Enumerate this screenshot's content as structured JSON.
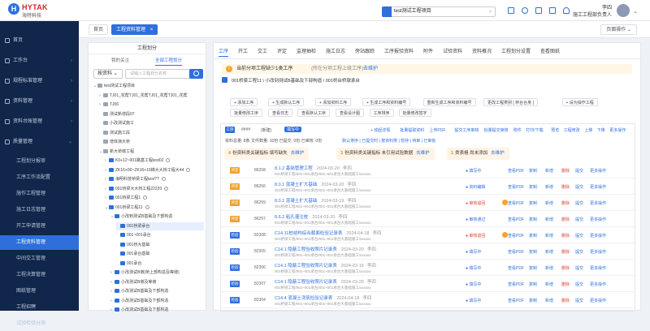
{
  "brand": {
    "logo_en": "HYTAK",
    "logo_cn": "海特科技"
  },
  "header": {
    "project": "test测试工程项目",
    "user_name": "李四",
    "user_role": "施工工程部负责人"
  },
  "sidebar": {
    "items": [
      {
        "label": "首页",
        "sub": false,
        "arrow": ""
      },
      {
        "label": "工作台",
        "sub": false,
        "arrow": "›"
      },
      {
        "label": "规程标准管理",
        "sub": false,
        "arrow": "›"
      },
      {
        "label": "资料管理",
        "sub": false,
        "arrow": "›"
      },
      {
        "label": "资料台账管理",
        "sub": false,
        "arrow": "›"
      },
      {
        "label": "质量管理",
        "sub": false,
        "arrow": "⌄"
      },
      {
        "label": "工程划分报审",
        "sub": true
      },
      {
        "label": "工序工作流配置",
        "sub": true
      },
      {
        "label": "施作工程管理",
        "sub": true
      },
      {
        "label": "施工日志管理",
        "sub": true
      },
      {
        "label": "开工申请管理",
        "sub": true
      },
      {
        "label": "工程资料管理",
        "sub": true,
        "active": true
      },
      {
        "label": "中间交工管理",
        "sub": true
      },
      {
        "label": "工程决算管理",
        "sub": true
      },
      {
        "label": "图纸管理",
        "sub": true
      },
      {
        "label": "工程招聘",
        "sub": true
      },
      {
        "label": "试验检验分项",
        "sub": true
      }
    ]
  },
  "tabs": {
    "home": "首页",
    "current": "工程资料管理",
    "close": "×",
    "page_ops": "页面操作 ⌄"
  },
  "tree": {
    "title": "工程划分",
    "subtabs": [
      "我的关注",
      "全部工程划分"
    ],
    "select": "按资料",
    "search_placeholder": "请输入工程划分名称",
    "nodes": [
      {
        "label": "test测试工程项目",
        "indent": 0,
        "caret": "⌄",
        "icon": "fo"
      },
      {
        "label": "TJ01_花帮TJ01_花帮TJ01_花帮TJ01_花帮",
        "indent": 1,
        "caret": "›",
        "icon": "fo"
      },
      {
        "label": "TJ06",
        "indent": 1,
        "caret": "›",
        "icon": "fo"
      },
      {
        "label": "测试新增段07",
        "indent": 1,
        "caret": "",
        "icon": "fo"
      },
      {
        "label": "小改测试施工",
        "indent": 1,
        "caret": "",
        "icon": "fo"
      },
      {
        "label": "测试施工段",
        "indent": 1,
        "caret": "",
        "icon": "fo"
      },
      {
        "label": "增体演大桥",
        "indent": 1,
        "caret": "",
        "icon": "fo"
      },
      {
        "label": "新大桥墩工程",
        "indent": 1,
        "caret": "⌄",
        "icon": "fo"
      },
      {
        "label": "K0+12~001路基工程test02",
        "indent": 2,
        "caret": "›",
        "icon": "fb",
        "badge": true
      },
      {
        "label": "ZK16+00~ZK16+16梯大大桥工程大44",
        "indent": 2,
        "caret": "›",
        "icon": "fb",
        "badge": true
      },
      {
        "label": "海明科技桥梁工程test??",
        "indent": 2,
        "caret": "›",
        "icon": "fb",
        "badge": true
      },
      {
        "label": "001桥梁大大桥工程22220",
        "indent": 2,
        "caret": "›",
        "icon": "fb",
        "badge": true
      },
      {
        "label": "001桥梁工程1",
        "indent": 2,
        "caret": "›",
        "icon": "fb",
        "badge": true
      },
      {
        "label": "001桥梁工程11",
        "indent": 2,
        "caret": "⌄",
        "icon": "fb",
        "badge": true
      },
      {
        "label": "小改到测试B基础及下部构造",
        "indent": 3,
        "caret": "⌄",
        "icon": "fb"
      },
      {
        "label": "001桥梁承台",
        "indent": 4,
        "caret": "",
        "icon": "fb",
        "selected": true
      },
      {
        "label": "001~001承台",
        "indent": 4,
        "caret": "",
        "icon": "fb"
      },
      {
        "label": "001桥大基础",
        "indent": 4,
        "caret": "",
        "icon": "fb"
      },
      {
        "label": "001承台基础",
        "indent": 4,
        "caret": "",
        "icon": "fb"
      },
      {
        "label": "001承台",
        "indent": 4,
        "caret": "",
        "icon": "fb"
      },
      {
        "label": "小改测试B墩(桥上部构造及等墩)",
        "indent": 3,
        "caret": "›",
        "icon": "fb"
      },
      {
        "label": "小改测试B墩及等墩",
        "indent": 3,
        "caret": "›",
        "icon": "fb"
      },
      {
        "label": "小改测试B基础及下部构造",
        "indent": 3,
        "caret": "›",
        "icon": "fb"
      },
      {
        "label": "小改测试B基础及下部构造",
        "indent": 3,
        "caret": "›",
        "icon": "fb"
      },
      {
        "label": "小改测试B基础及下部构造",
        "indent": 3,
        "caret": "›",
        "icon": "fb"
      }
    ]
  },
  "main_tabs": [
    "工序",
    "开工",
    "交工",
    "评定",
    "监理抽检",
    "施工日志",
    "旁站跟踪",
    "工序报验资料",
    "附件",
    "试验资料",
    "资料概况",
    "工程划分设置",
    "查看图纸"
  ],
  "alert": {
    "text": "当前分项工程缺少1类工序",
    "sub": "(所在分项工程上级工序)",
    "link": "去维护"
  },
  "path": "001桥梁工程11 \\ 小改到测试B基础及下部构造 \\ 001桥台桥墩承台",
  "actions_row1": [
    "+ 添加工序",
    "+ 生成默认工序",
    "+ 添加资料工序",
    "+ 生成工序和资料编号",
    "重新生成工序和资料编号",
    "更改工程类别 [ 桥台台身 ]",
    "+ 设为操作工程"
  ],
  "actions_row2": [
    "批量修改工序",
    "查看日志",
    "查看默认工序",
    "查看设计图",
    "工序排序",
    "批量修改签字"
  ],
  "list": {
    "tag": "工序",
    "filter_placeholder": "####",
    "filter_label": "(新建)",
    "status": "填写中",
    "links": [
      "+ 收起详情",
      "批量提取资料",
      "上传PDF",
      "提交工序审核",
      "批量提交审核",
      "附件",
      "打印/下载",
      "预览",
      "工程修改",
      "上移",
      "下移",
      "更多操作"
    ],
    "stats": "资料总量: 8条    文件数量: 10份    已提交: 0份    已审核: 0份",
    "filters_text": "默认排序 | 已提交时 | 按资料类 | 暂存 | 待审 | 已审批",
    "cards": [
      {
        "count": "4",
        "text": "份资料类关键指标 填写缺失"
      },
      {
        "count": "3",
        "text": "份资料类关键指标 未引用试验数据"
      },
      {
        "count": "1",
        "text": "类表格 尚未添加"
      }
    ],
    "rows": [
      {
        "tag": "评定",
        "tagc": "#f0a030",
        "id": "86258",
        "title": "8.1.2 基础管理工程",
        "meta": "2024-03-20",
        "user": "李四",
        "sub": "001桥梁工程/001~001承台/001~001承台大基础施工/xxxxxx",
        "status": "● 填写中",
        "sc": "#2f6fdc",
        "pdf": true
      },
      {
        "tag": "评定",
        "tagc": "#f0a030",
        "id": "86256",
        "title": "8.0.1 混凝土扩大基础",
        "meta": "2024-03-20",
        "user": "李四",
        "sub": "001桥梁工程/001~001承台/001~001承台大基础施工/xxxxxx",
        "status": "● 资料编辑",
        "sc": "#2f6fdc",
        "pdf": true
      },
      {
        "tag": "评定",
        "tagc": "#f0a030",
        "id": "86259",
        "title": "8.0.1 混凝土扩大基础",
        "meta": "2024-03-19",
        "user": "李四",
        "sub": "001桥梁工程/001~001承台/001~001承台大基础施工/xxxxxx",
        "status": "● 审核退回",
        "sc": "#e0463c",
        "pdf": false,
        "warn": true
      },
      {
        "tag": "评定",
        "tagc": "#f0a030",
        "id": "86257",
        "title": "8.6.2 粘孔灌注桩",
        "meta": "2024-03-20",
        "user": "李四",
        "sub": "001桥梁工程/001~001承台/001~001承台大基础施工/xxxxxx",
        "status": "● 审核通过",
        "sc": "#2f6fdc",
        "pdf": false
      },
      {
        "tag": "检验",
        "tagc": "#2f6fdc",
        "id": "82308",
        "title": "C14.11桩结构综合截面检验记录表",
        "meta": "2024-04-18",
        "user": "李四",
        "sub": "001桥梁工程/001~001承台/001~001承台大基础施工/xxxxxx",
        "status": "● 审核退回",
        "sc": "#e0463c",
        "pdf": false,
        "warn": true
      },
      {
        "tag": "检验",
        "tagc": "#2f6fdc",
        "id": "82305",
        "title": "C14.1 隐蔽工程验收照片记录表",
        "meta": "2024-03-20",
        "user": "李四",
        "sub": "001桥梁工程/001~001承台/001~001承台大基础施工/xxxxxx",
        "status": "● 填写中",
        "sc": "#2f6fdc",
        "pdf": false
      },
      {
        "tag": "检验",
        "tagc": "#2f6fdc",
        "id": "82306",
        "title": "C14.1 隐蔽工程验收照片记录表",
        "meta": "2024-03-16",
        "user": "李四",
        "sub": "001桥梁工程/001~001承台/001~001承台大基础施工/xxxxxx",
        "status": "● 填写中",
        "sc": "#2f6fdc",
        "pdf": false
      },
      {
        "tag": "检验",
        "tagc": "#2f6fdc",
        "id": "82307",
        "title": "C14.1 隐蔽工程验收照片记录表",
        "meta": "2024-03-20",
        "user": "李四",
        "sub": "001桥梁工程/001~001承台/001~001承台大基础施工/xxxxxx",
        "status": "● 填写中",
        "sc": "#2f6fdc",
        "pdf": false
      },
      {
        "tag": "检验",
        "tagc": "#2f6fdc",
        "id": "82304",
        "title": "C14.4 混凝土浇筑检验记录表",
        "meta": "2024-04-18",
        "user": "李四",
        "sub": "001桥梁工程/001~001承台/001~001承台大基础施工/xxxxxx",
        "status": "● 填写中",
        "sc": "#2f6fdc",
        "pdf": false
      }
    ],
    "row_actions": [
      "查看PDF",
      "复制",
      "新增",
      "删除",
      "提交",
      "更多操作"
    ]
  },
  "colors": {
    "primary": "#2f6fdc",
    "sidebar": "#10264a",
    "warn": "#f5a623",
    "danger": "#e0463c"
  }
}
